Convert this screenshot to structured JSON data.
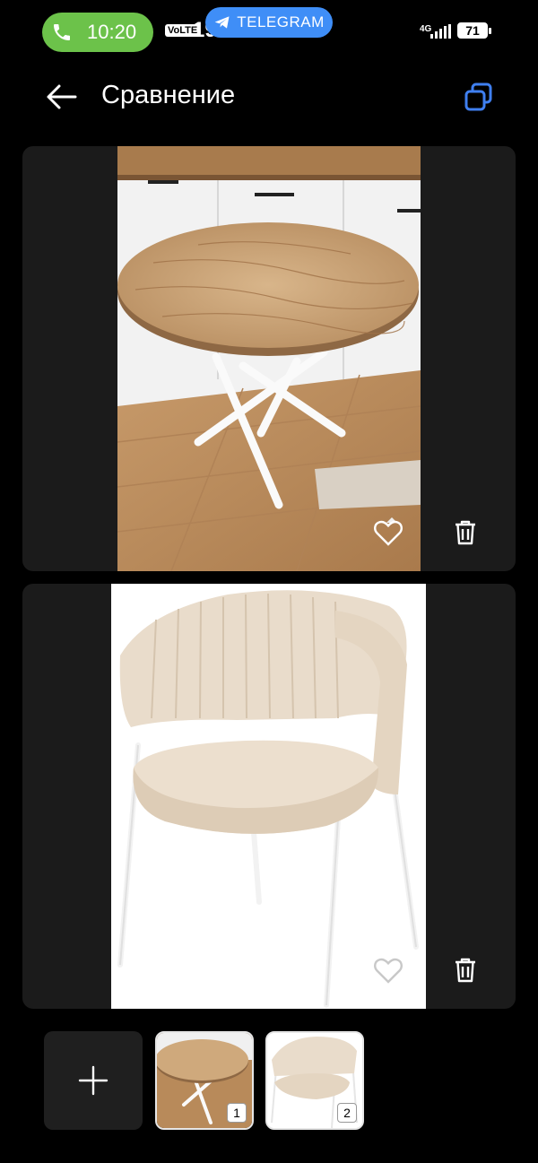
{
  "status_bar": {
    "call_time": "10:20",
    "volte": "VoLTE",
    "clock_partial": "19:33",
    "telegram_label": "TELEGRAM",
    "network": "4G",
    "battery": "71"
  },
  "header": {
    "title": "Сравнение",
    "back_icon": "arrow-left-icon",
    "compare_icon": "copy-compare-icon"
  },
  "items": [
    {
      "index_label": "1",
      "favorite_icon": "heart-outline-icon",
      "delete_icon": "trash-icon"
    },
    {
      "index_label": "2",
      "favorite_icon": "heart-outline-icon",
      "delete_icon": "trash-icon"
    }
  ],
  "bottom_strip": {
    "add_icon": "plus-icon"
  },
  "colors": {
    "accent": "#3f8ef7",
    "call_green": "#6cc24a",
    "compare_icon_blue": "#3f7ff0",
    "card_bg": "#1b1b1b"
  }
}
